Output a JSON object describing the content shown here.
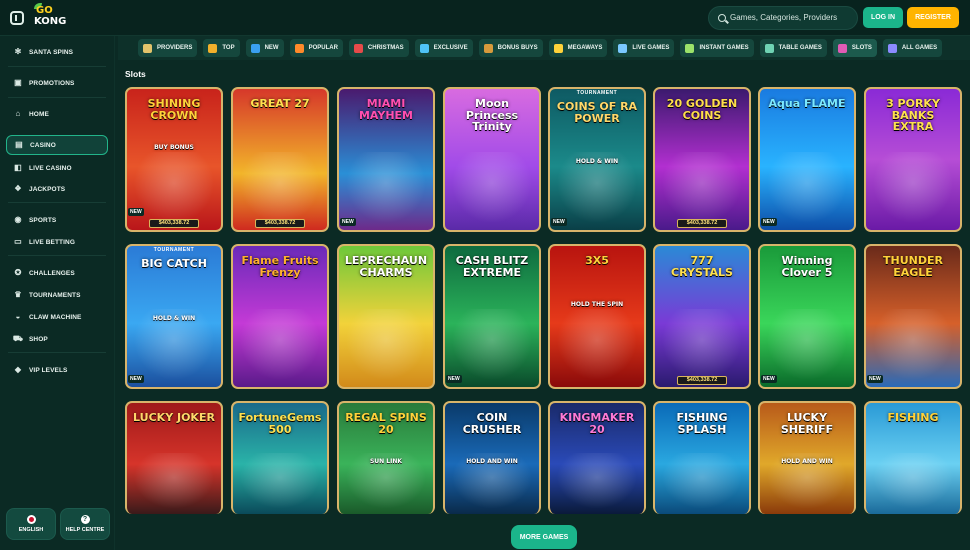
{
  "header": {
    "logo_line1": "GO",
    "logo_line2": "KONG",
    "search_placeholder": "Games, Categories, Providers",
    "login_label": "LOG IN",
    "register_label": "REGISTER"
  },
  "sidebar": {
    "items": [
      {
        "label": "SANTA SPINS",
        "icon": "snowflake-icon"
      },
      {
        "label": "PROMOTIONS",
        "icon": "gift-icon"
      },
      {
        "label": "HOME",
        "icon": "home-icon"
      },
      {
        "label": "CASINO",
        "icon": "cards-icon"
      },
      {
        "label": "LIVE CASINO",
        "icon": "live-dealer-icon"
      },
      {
        "label": "JACKPOTS",
        "icon": "coins-icon"
      },
      {
        "label": "SPORTS",
        "icon": "ball-icon"
      },
      {
        "label": "LIVE BETTING",
        "icon": "monitor-icon"
      },
      {
        "label": "CHALLENGES",
        "icon": "medal-icon"
      },
      {
        "label": "TOURNAMENTS",
        "icon": "trophy-icon"
      },
      {
        "label": "CLAW MACHINE",
        "icon": "claw-icon"
      },
      {
        "label": "SHOP",
        "icon": "cart-icon"
      },
      {
        "label": "VIP LEVELS",
        "icon": "diamond-icon"
      }
    ],
    "active": "CASINO",
    "language_label": "ENGLISH",
    "help_label": "HELP CENTRE"
  },
  "categories": [
    "PROVIDERS",
    "TOP",
    "NEW",
    "POPULAR",
    "CHRISTMAS",
    "EXCLUSIVE",
    "BONUS BUYS",
    "MEGAWAYS",
    "LIVE GAMES",
    "INSTANT GAMES",
    "TABLE GAMES",
    "SLOTS",
    "ALL GAMES"
  ],
  "selected_category": "SLOTS",
  "section_title": "Slots",
  "games": [
    {
      "title": "SHINING CROWN",
      "subtitle": "BUY BONUS",
      "jackpot": "$403,338.72",
      "new": true,
      "tournament": false
    },
    {
      "title": "GREAT 27",
      "subtitle": "",
      "jackpot": "$403,338.72",
      "new": false,
      "tournament": false
    },
    {
      "title": "MIAMI MAYHEM",
      "subtitle": "",
      "jackpot": "",
      "new": true,
      "tournament": false
    },
    {
      "title": "Moon Princess Trinity",
      "subtitle": "",
      "jackpot": "",
      "new": false,
      "tournament": false
    },
    {
      "title": "COINS OF RA POWER",
      "subtitle": "HOLD & WIN",
      "jackpot": "",
      "new": true,
      "tournament": true
    },
    {
      "title": "20 GOLDEN COINS",
      "subtitle": "",
      "jackpot": "$403,338.72",
      "new": false,
      "tournament": false
    },
    {
      "title": "Aqua FLAME",
      "subtitle": "",
      "jackpot": "",
      "new": true,
      "tournament": false
    },
    {
      "title": "3 PORKY BANKS EXTRA",
      "subtitle": "",
      "jackpot": "",
      "new": false,
      "tournament": false
    },
    {
      "title": "BIG CATCH",
      "subtitle": "HOLD & WIN",
      "jackpot": "",
      "new": true,
      "tournament": true
    },
    {
      "title": "Flame Fruits Frenzy",
      "subtitle": "",
      "jackpot": "",
      "new": false,
      "tournament": false
    },
    {
      "title": "LEPRECHAUN CHARMS",
      "subtitle": "",
      "jackpot": "",
      "new": false,
      "tournament": false
    },
    {
      "title": "CASH BLITZ EXTREME",
      "subtitle": "",
      "jackpot": "",
      "new": true,
      "tournament": false
    },
    {
      "title": "3X5",
      "subtitle": "HOLD THE SPIN",
      "jackpot": "",
      "new": false,
      "tournament": false
    },
    {
      "title": "777 CRYSTALS",
      "subtitle": "",
      "jackpot": "$403,338.72",
      "new": false,
      "tournament": false
    },
    {
      "title": "Winning Clover 5",
      "subtitle": "",
      "jackpot": "",
      "new": true,
      "tournament": false
    },
    {
      "title": "THUNDER EAGLE",
      "subtitle": "",
      "jackpot": "",
      "new": true,
      "tournament": false
    },
    {
      "title": "LUCKY JOKER",
      "subtitle": "",
      "jackpot": "",
      "new": false,
      "tournament": false
    },
    {
      "title": "FortuneGems 500",
      "subtitle": "",
      "jackpot": "",
      "new": false,
      "tournament": false
    },
    {
      "title": "REGAL SPINS 20",
      "subtitle": "SUN LINK",
      "jackpot": "",
      "new": false,
      "tournament": false
    },
    {
      "title": "COIN CRUSHER",
      "subtitle": "HOLD AND WIN",
      "jackpot": "",
      "new": false,
      "tournament": false
    },
    {
      "title": "KINGMAKER 20",
      "subtitle": "",
      "jackpot": "",
      "new": false,
      "tournament": false
    },
    {
      "title": "FISHING SPLASH",
      "subtitle": "",
      "jackpot": "",
      "new": false,
      "tournament": false
    },
    {
      "title": "LUCKY SHERIFF",
      "subtitle": "HOLD AND WIN",
      "jackpot": "",
      "new": false,
      "tournament": false
    },
    {
      "title": "FISHING",
      "subtitle": "",
      "jackpot": "",
      "new": false,
      "tournament": false
    }
  ],
  "tournament_label": "TOURNAMENT",
  "new_badge_label": "NEW",
  "more_games_label": "MORE GAMES",
  "colors": {
    "background": "#0b2a24",
    "accent_green": "#1bb58b",
    "accent_yellow": "#ffb400",
    "tile_border": "#d8b46a"
  }
}
